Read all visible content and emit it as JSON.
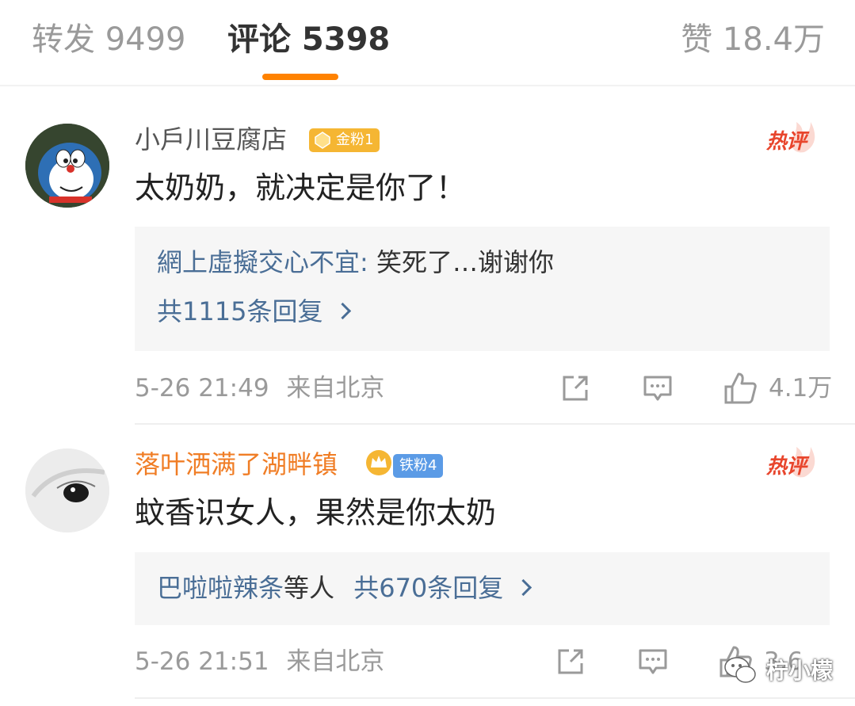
{
  "tabs": {
    "repost": "转发 9499",
    "comment": "评论 5398",
    "like": "赞 18.4万"
  },
  "colors": {
    "accent": "#ff8200",
    "link_blue": "#4a6e96",
    "hot_red": "#e8452c",
    "gold_badge": "#f5b633",
    "fan_blue": "#5b9be6",
    "vip_orange": "#f07d25"
  },
  "comments": [
    {
      "username": "小戶川豆腐店",
      "badge": "金粉1",
      "hot_label": "热评",
      "text": "太奶奶，就决定是你了！",
      "reply": {
        "author": "網上虛擬交心不宜:",
        "content": " 笑死了…谢谢你",
        "more": "共1115条回复"
      },
      "time": "5-26 21:49",
      "location": "来自北京",
      "likes": "4.1万"
    },
    {
      "username": "落叶洒满了湖畔镇",
      "badge": "铁粉4",
      "hot_label": "热评",
      "text": "蚊香识女人，果然是你太奶",
      "reply": {
        "author": "巴啦啦辣条",
        "content": "等人",
        "more": "共670条回复"
      },
      "time": "5-26 21:51",
      "location": "来自北京",
      "likes": "3.6"
    }
  ],
  "watermark": "柠小檬"
}
